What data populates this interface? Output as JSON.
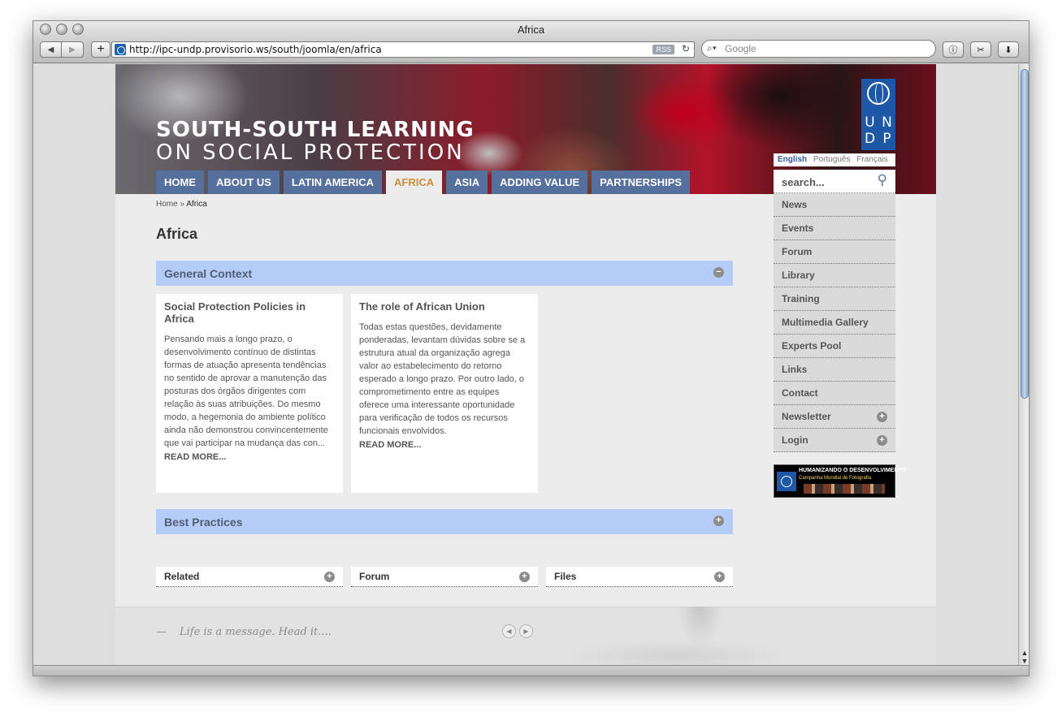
{
  "window": {
    "title": "Africa"
  },
  "browser": {
    "url": "http://ipc-undp.provisorio.ws/south/joomla/en/africa",
    "rss_label": "RSS",
    "search_placeholder": "Google"
  },
  "site": {
    "title_line1": "SOUTH-SOUTH LEARNING",
    "title_line2": "ON SOCIAL PROTECTION",
    "logo_letters": [
      "U",
      "N",
      "D",
      "P"
    ],
    "languages": [
      "English",
      "Português",
      "Français"
    ],
    "active_language": "English"
  },
  "nav": {
    "items": [
      "HOME",
      "ABOUT US",
      "LATIN AMERICA",
      "AFRICA",
      "ASIA",
      "ADDING VALUE",
      "PARTNERSHIPS"
    ],
    "active": "AFRICA"
  },
  "breadcrumb": {
    "home": "Home",
    "sep": "»",
    "current": "Africa"
  },
  "page": {
    "title": "Africa"
  },
  "sections": {
    "general_context": {
      "label": "General Context",
      "toggle": "−"
    },
    "best_practices": {
      "label": "Best Practices",
      "toggle": "+"
    }
  },
  "cards": [
    {
      "title": "Social Protection Policies in Africa",
      "body": "Pensando mais a longo prazo, o desenvolvimento contínuo de distintas formas de atuação apresenta tendências no sentido de aprovar a manutenção das posturas dos órgãos dirigentes com relação às suas atribuições. Do mesmo modo, a hegemonia do ambiente político ainda não demonstrou convincentemente que vai participar na mudança das con...",
      "more": "READ MORE..."
    },
    {
      "title": "The role of African Union",
      "body": "Todas estas questões, devidamente ponderadas, levantam dúvidas sobre se a estrutura atual da organização agrega valor ao estabelecimento do retorno esperado a longo prazo. Por outro lado, o comprometimento entre as equipes oferece uma interessante oportunidade para verificação de todos os recursos funcionais envolvidos.",
      "more": "READ MORE..."
    }
  ],
  "bottom_boxes": [
    "Related",
    "Forum",
    "Files"
  ],
  "sidebar": {
    "search_placeholder": "search...",
    "items": [
      "News",
      "Events",
      "Forum",
      "Library",
      "Training",
      "Multimedia Gallery",
      "Experts Pool",
      "Links",
      "Contact",
      "Newsletter",
      "Login"
    ],
    "expandable": [
      "Newsletter",
      "Login"
    ],
    "banner_title": "HUMANIZANDO O DESENVOLVIMENTO",
    "banner_subtitle": "Campanha Mundial de Fotografia"
  },
  "footer": {
    "dash": "—",
    "quote": "Life is a message. Head it...."
  },
  "colors": {
    "nav_bg": "#55709c",
    "nav_active_text": "#c8913d",
    "section_bar": "#b5ccf6",
    "undp_blue": "#1d58a6"
  }
}
